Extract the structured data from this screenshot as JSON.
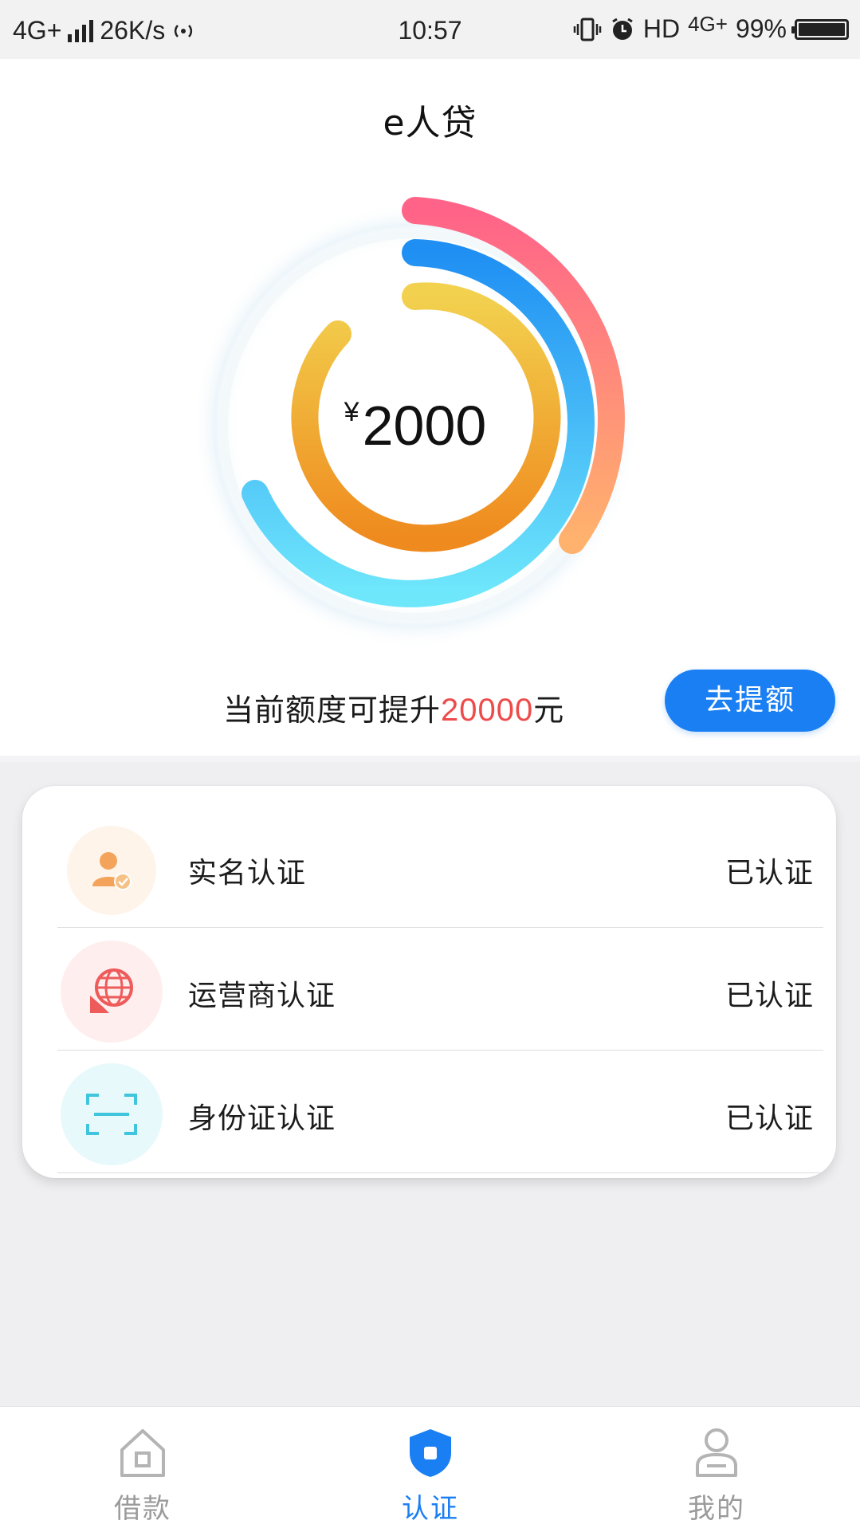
{
  "status_bar": {
    "network": "4G+",
    "speed": "26K/s",
    "time": "10:57",
    "hd": "HD",
    "network_right": "4G+",
    "battery": "99%"
  },
  "header": {
    "title": "e人贷"
  },
  "credit": {
    "currency": "¥",
    "amount": "2000",
    "promo_prefix": "当前额度可提升",
    "promo_amount": "20000",
    "promo_suffix": "元",
    "raise_button": "去提额",
    "ring_colors": [
      "#ff6f8d",
      "#1f8ff3",
      "#f0ac2f"
    ]
  },
  "verifications": [
    {
      "label": "实名认证",
      "status": "已认证",
      "icon": "user-check-icon",
      "color": "#f3a45a"
    },
    {
      "label": "运营商认证",
      "status": "已认证",
      "icon": "globe-icon",
      "color": "#ee5b5b"
    },
    {
      "label": "身份证认证",
      "status": "已认证",
      "icon": "scan-icon",
      "color": "#3fc5dc"
    }
  ],
  "bottom_nav": [
    {
      "label": "借款",
      "icon": "home-icon",
      "active": false
    },
    {
      "label": "认证",
      "icon": "shield-icon",
      "active": true
    },
    {
      "label": "我的",
      "icon": "profile-icon",
      "active": false
    }
  ],
  "accent_color": "#1b7ff4"
}
